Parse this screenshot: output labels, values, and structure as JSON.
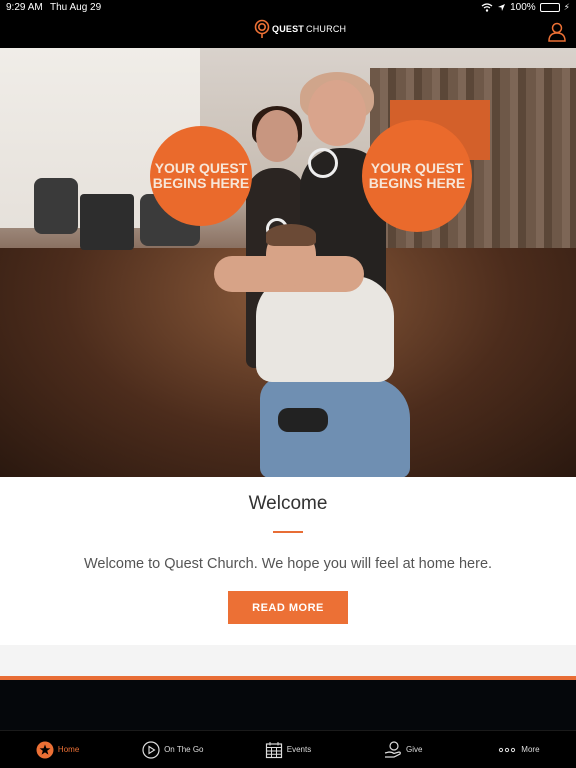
{
  "status": {
    "time": "9:29 AM",
    "date": "Thu Aug 29",
    "battery": "100%",
    "battery_level": 1.0
  },
  "header": {
    "logo_text_bold": "QUEST",
    "logo_text": "CHURCH"
  },
  "hero": {
    "sign_text": "YOUR QUEST BEGINS HERE"
  },
  "card": {
    "title": "Welcome",
    "body": "Welcome to Quest Church. We hope you will feel at home here.",
    "button": "READ MORE"
  },
  "tabs": [
    {
      "label": "Home",
      "icon": "star-icon",
      "active": true
    },
    {
      "label": "On The Go",
      "icon": "play-icon",
      "active": false
    },
    {
      "label": "Events",
      "icon": "calendar-icon",
      "active": false
    },
    {
      "label": "Give",
      "icon": "give-icon",
      "active": false
    },
    {
      "label": "More",
      "icon": "more-icon",
      "active": false
    }
  ],
  "colors": {
    "accent": "#ec7035",
    "background": "#000000",
    "card": "#ffffff"
  }
}
